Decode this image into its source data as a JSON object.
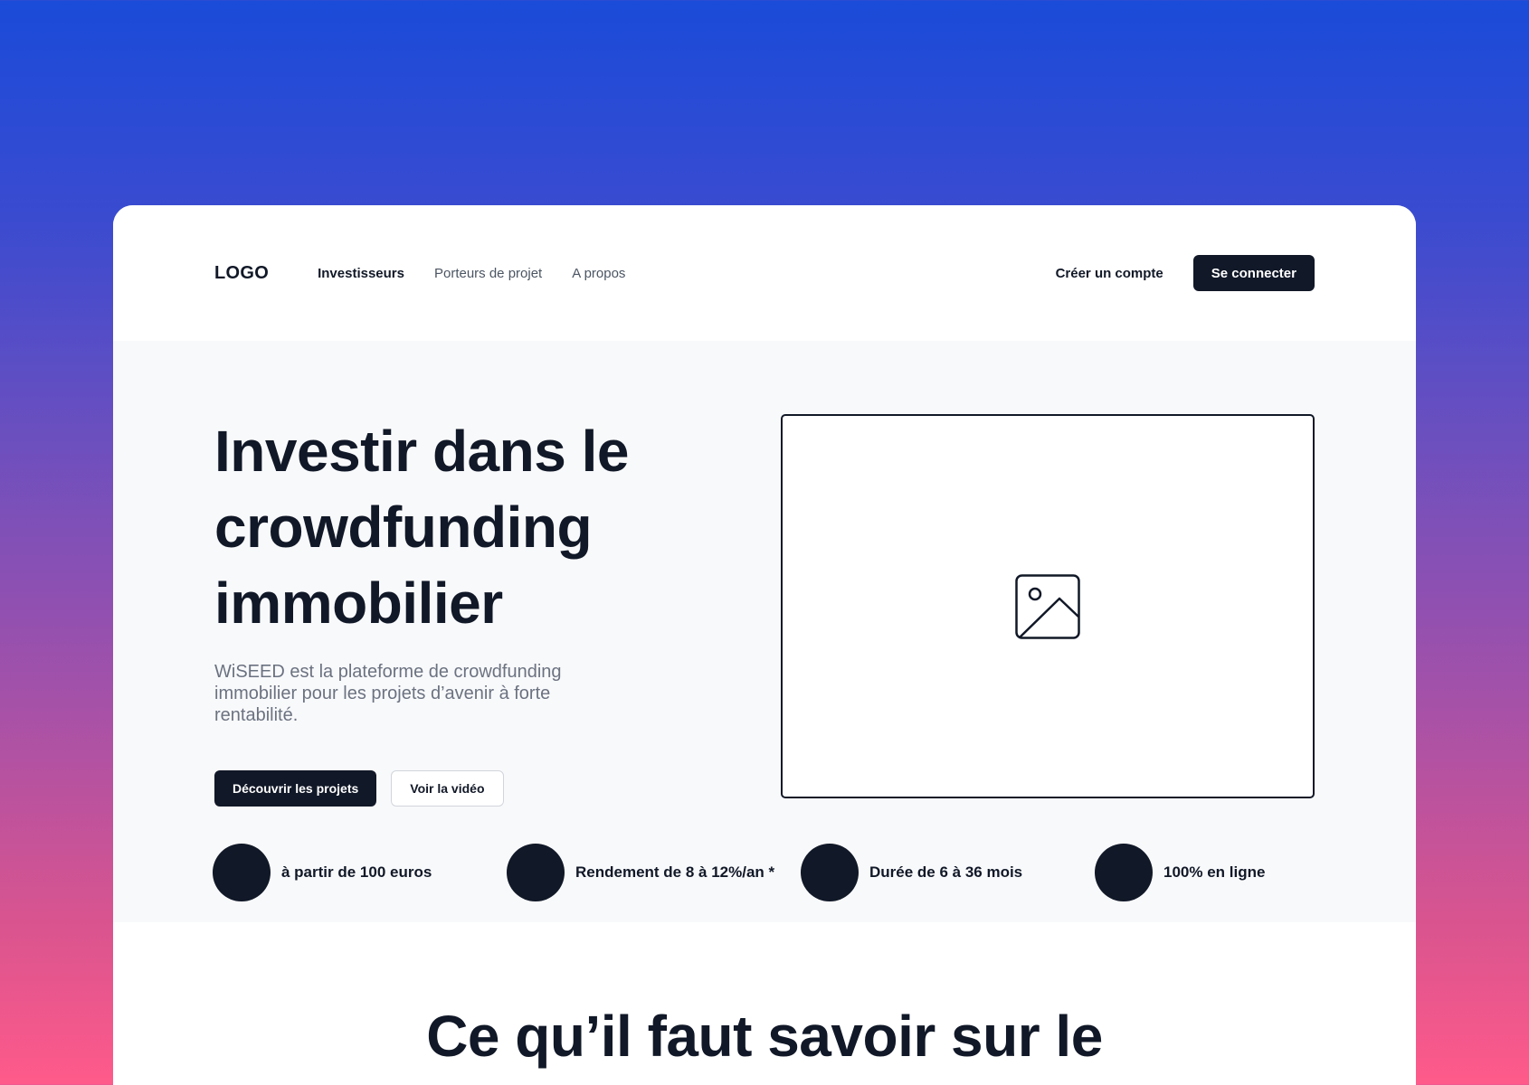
{
  "nav": {
    "logo": "LOGO",
    "links": [
      "Investisseurs",
      "Porteurs de projet",
      "A propos"
    ],
    "create_account": "Créer un compte",
    "login": "Se connecter"
  },
  "hero": {
    "title_lines": [
      "Investir dans le",
      "crowdfunding",
      "immobilier"
    ],
    "subtitle": "WiSEED est la plateforme de crowdfunding immobilier pour les projets d’avenir à forte rentabilité.",
    "primary_button": "Découvrir les projets",
    "secondary_button": "Voir la vidéo",
    "image_icon": "image-placeholder-icon"
  },
  "features": [
    "à partir de 100 euros",
    "Rendement de 8 à 12%/an *",
    "Durée de 6 à 36 mois",
    "100% en ligne"
  ],
  "section": {
    "title": "Ce qu’il faut savoir sur le"
  },
  "colors": {
    "dark": "#111827",
    "gradient_top": "#1a4bd9",
    "gradient_bottom": "#ff5a8a",
    "hero_bg": "#f8f9fb"
  }
}
